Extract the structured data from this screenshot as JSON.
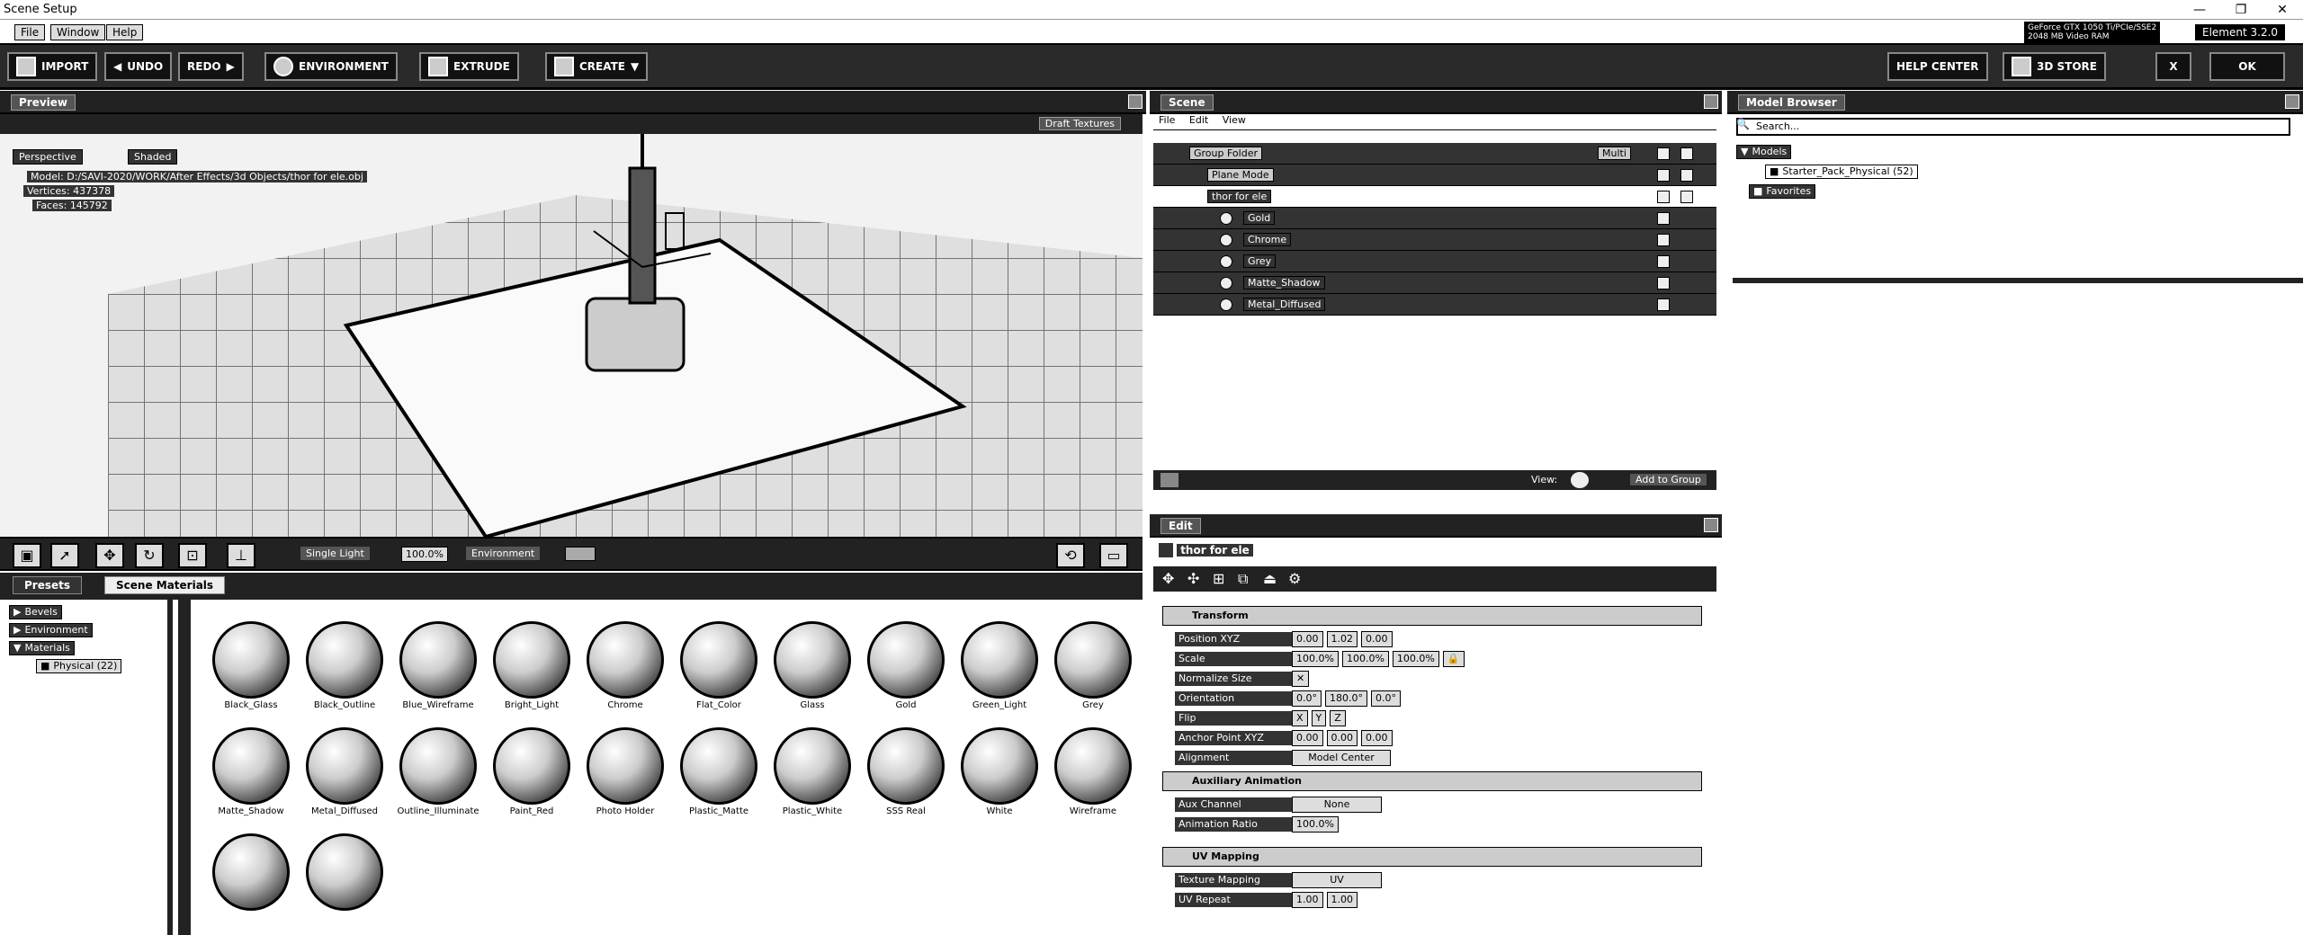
{
  "window": {
    "title": "Scene Setup",
    "min": "—",
    "restore": "❐",
    "close": "✕"
  },
  "menu": {
    "file": "File",
    "window": "Window",
    "help": "Help"
  },
  "gpu": {
    "line1": "GeForce GTX 1050 Ti/PCIe/SSE2",
    "line2": "2048 MB Video RAM"
  },
  "element_badge": "Element 3.2.0",
  "toolbar": {
    "import": "IMPORT",
    "undo": "UNDO",
    "redo": "REDO",
    "environment": "ENVIRONMENT",
    "extrude": "EXTRUDE",
    "create": "CREATE",
    "help_center": "HELP CENTER",
    "store": "3D STORE",
    "close": "X",
    "ok": "OK"
  },
  "preview": {
    "header": "Preview",
    "draft_textures": "Draft Textures",
    "perspective": "Perspective",
    "shaded": "Shaded",
    "model_line": "Model: D:/SAVI-2020/WORK/After Effects/3d Objects/thor for ele.obj",
    "vertices_label": "Vertices:",
    "vertices": "437378",
    "faces_label": "Faces:",
    "faces": "145792",
    "light": "Single Light",
    "light_pct": "100.0%",
    "environment": "Environment"
  },
  "bottom_tabs": {
    "presets": "Presets",
    "scene_materials": "Scene Materials"
  },
  "tree": {
    "bevels": "Bevels",
    "environment": "Environment",
    "materials": "Materials",
    "physical": "Physical (22)"
  },
  "materials": [
    "Black_Glass",
    "Black_Outline",
    "Blue_Wireframe",
    "Bright_Light",
    "Chrome",
    "Flat_Color",
    "Glass",
    "Gold",
    "Green_Light",
    "Grey",
    "Matte_Shadow",
    "Metal_Diffused",
    "Outline_Illuminate",
    "Paint_Red",
    "Photo Holder",
    "Plastic_Matte",
    "Plastic_White",
    "SSS Real",
    "White",
    "Wireframe",
    "",
    ""
  ],
  "scene": {
    "header": "Scene",
    "menu": {
      "file": "File",
      "edit": "Edit",
      "view": "View"
    },
    "group_folder": "Group Folder",
    "group_mode": "Multi",
    "plane_mode": "Plane Mode",
    "object": "thor for ele",
    "mats": [
      "Gold",
      "Chrome",
      "Grey",
      "Matte_Shadow",
      "Metal_Diffused"
    ],
    "view_label": "View:",
    "add_to_group": "Add to Group"
  },
  "edit": {
    "header": "Edit",
    "object": "thor for ele",
    "transform": "Transform",
    "position_label": "Position XYZ",
    "position": [
      "0.00",
      "1.02",
      "0.00"
    ],
    "scale_label": "Scale",
    "scale": [
      "100.0%",
      "100.0%",
      "100.0%"
    ],
    "normalize_label": "Normalize Size",
    "orientation_label": "Orientation",
    "orientation": [
      "0.0°",
      "180.0°",
      "0.0°"
    ],
    "flip_label": "Flip",
    "flip": [
      "X",
      "Y",
      "Z"
    ],
    "anchor_label": "Anchor Point XYZ",
    "anchor": [
      "0.00",
      "0.00",
      "0.00"
    ],
    "alignment_label": "Alignment",
    "alignment": "Model Center",
    "aux_anim": "Auxiliary Animation",
    "aux_channel_label": "Aux Channel",
    "aux_channel": "None",
    "anim_ratio_label": "Animation Ratio",
    "anim_ratio": "100.0%",
    "uv": "UV Mapping",
    "tex_map_label": "Texture Mapping",
    "tex_map": "UV",
    "uv_repeat_label": "UV Repeat",
    "uv_repeat": [
      "1.00",
      "1.00"
    ]
  },
  "browser": {
    "header": "Model Browser",
    "search": "Search...",
    "models": "Models",
    "starter": "Starter_Pack_Physical (52)",
    "favorites": "Favorites"
  }
}
